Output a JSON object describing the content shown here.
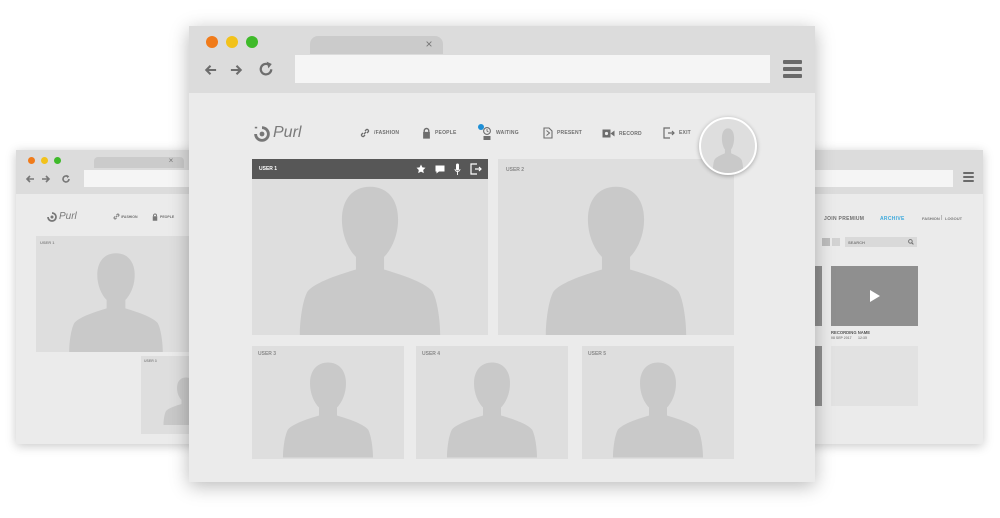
{
  "logo": {
    "text": "Purl"
  },
  "nav": {
    "fashion": "/FASHION",
    "people": "PEOPLE",
    "waiting": "WAITING",
    "present": "PRESENT",
    "record": "RECORD",
    "exit": "EXIT",
    "small_fashion": "/FASHION",
    "small_people": "PEOPLE"
  },
  "tiles": {
    "user1": "USER 1",
    "user2": "USER 2",
    "user3": "USER 3",
    "user4": "USER 4",
    "user5": "USER 5",
    "small_user1": "USER 1",
    "small_user3": "USER 3"
  },
  "archive": {
    "join_premium": "JOIN PREMIUM",
    "archive": "ARCHIVE",
    "user_menu": "FASHION",
    "separator": "|",
    "logout": "LOGOUT",
    "search_placeholder": "SEARCH",
    "recording_name": "RECORDING NAME",
    "recording_date": "08 SEP 2017",
    "recording_time": "12:35"
  },
  "colors": {
    "close": "#f07b1a",
    "minimize": "#f2c21b",
    "maximize": "#3fba2a",
    "accent": "#3ca9dc",
    "badge": "#1e8fd6",
    "active_header": "#575757"
  },
  "icons": {
    "back": "arrow-left-icon",
    "forward": "arrow-right-icon",
    "reload": "reload-icon",
    "menu": "hamburger-menu-icon",
    "link": "link-icon",
    "lock": "lock-icon",
    "waiting": "person-waiting-icon",
    "present": "document-present-icon",
    "record": "video-camera-icon",
    "exit": "exit-door-icon",
    "star": "star-icon",
    "chat": "chat-bubble-icon",
    "mic": "microphone-icon",
    "leave": "exit-door-icon",
    "play": "play-icon",
    "search": "magnifier-icon",
    "grid": "grid-view-icon",
    "list": "list-view-icon"
  }
}
